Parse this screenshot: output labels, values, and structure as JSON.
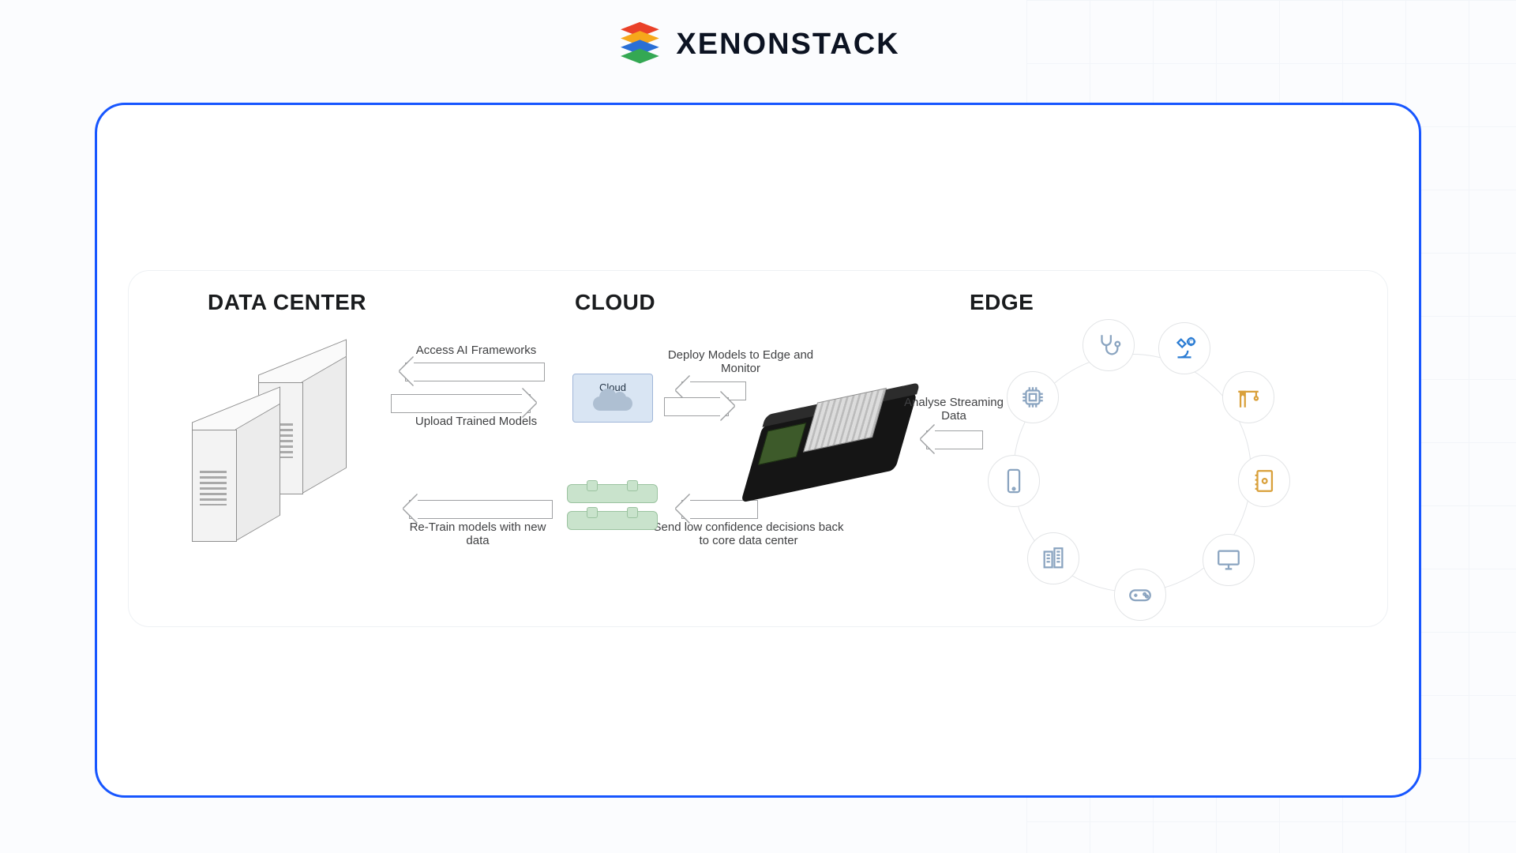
{
  "brand": {
    "name": "XENONSTACK"
  },
  "columns": {
    "data_center": "DATA CENTER",
    "cloud": "CLOUD",
    "edge": "EDGE"
  },
  "cloud_tile": {
    "label": "Cloud"
  },
  "flows": {
    "access_ai": "Access AI Frameworks",
    "upload_models": "Upload Trained Models",
    "retrain": "Re-Train models with new data",
    "deploy_monitor": "Deploy Models to Edge and Monitor",
    "low_conf": "Send low confidence decisions back to core data center",
    "analyse": "Analyse Streaming Data"
  },
  "ring_icons": [
    "stethoscope-icon",
    "microscope-gear-icon",
    "crane-icon",
    "notebook-icon",
    "monitor-icon",
    "gamepad-icon",
    "buildings-icon",
    "phone-icon",
    "chip-icon"
  ]
}
